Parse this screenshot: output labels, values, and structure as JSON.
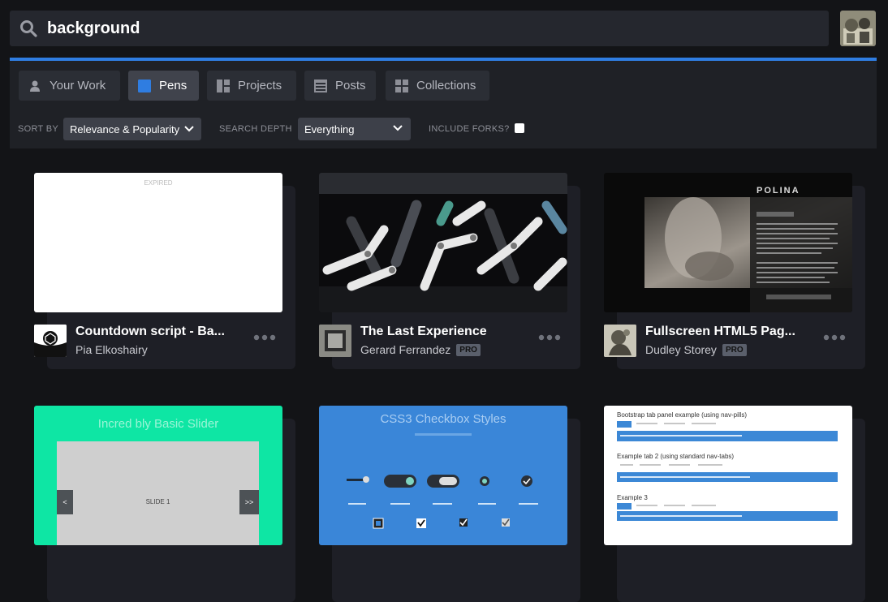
{
  "search": {
    "value": "background",
    "placeholder": ""
  },
  "tabs": [
    {
      "label": "Your Work",
      "icon": "user-icon"
    },
    {
      "label": "Pens",
      "icon": "pen-square-icon",
      "active": true
    },
    {
      "label": "Projects",
      "icon": "projects-icon"
    },
    {
      "label": "Posts",
      "icon": "posts-icon"
    },
    {
      "label": "Collections",
      "icon": "collections-icon"
    }
  ],
  "filters": {
    "sort_label": "SORT BY",
    "sort_value": "Relevance & Popularity",
    "depth_label": "SEARCH DEPTH",
    "depth_value": "Everything",
    "forks_label": "INCLUDE FORKS?",
    "forks_checked": false
  },
  "colors": {
    "accent": "#2f7de1",
    "background": "#131417",
    "panel": "#1f2126"
  },
  "pens": [
    {
      "title": "Countdown script - Ba...",
      "author": "Pia Elkoshairy",
      "pro": false,
      "badge": "",
      "thumb_text": "EXPIRED"
    },
    {
      "title": "The Last Experience",
      "author": "Gerard Ferrandez",
      "pro": true,
      "badge": "PRO"
    },
    {
      "title": "Fullscreen HTML5 Pag...",
      "author": "Dudley Storey",
      "pro": true,
      "badge": "PRO",
      "thumb_text": "POLINA"
    },
    {
      "thumb_text": "Incred bly Basic Slider",
      "slide_label": "SLIDE 1",
      "prev": "<",
      "next": ">>"
    },
    {
      "thumb_text": "CSS3 Checkbox Styles"
    },
    {
      "thumb_heading_1": "Bootstrap tab panel example (using nav-pills)",
      "thumb_heading_2": "Example tab 2 (using standard nav-tabs)",
      "thumb_heading_3": "Example 3"
    }
  ]
}
